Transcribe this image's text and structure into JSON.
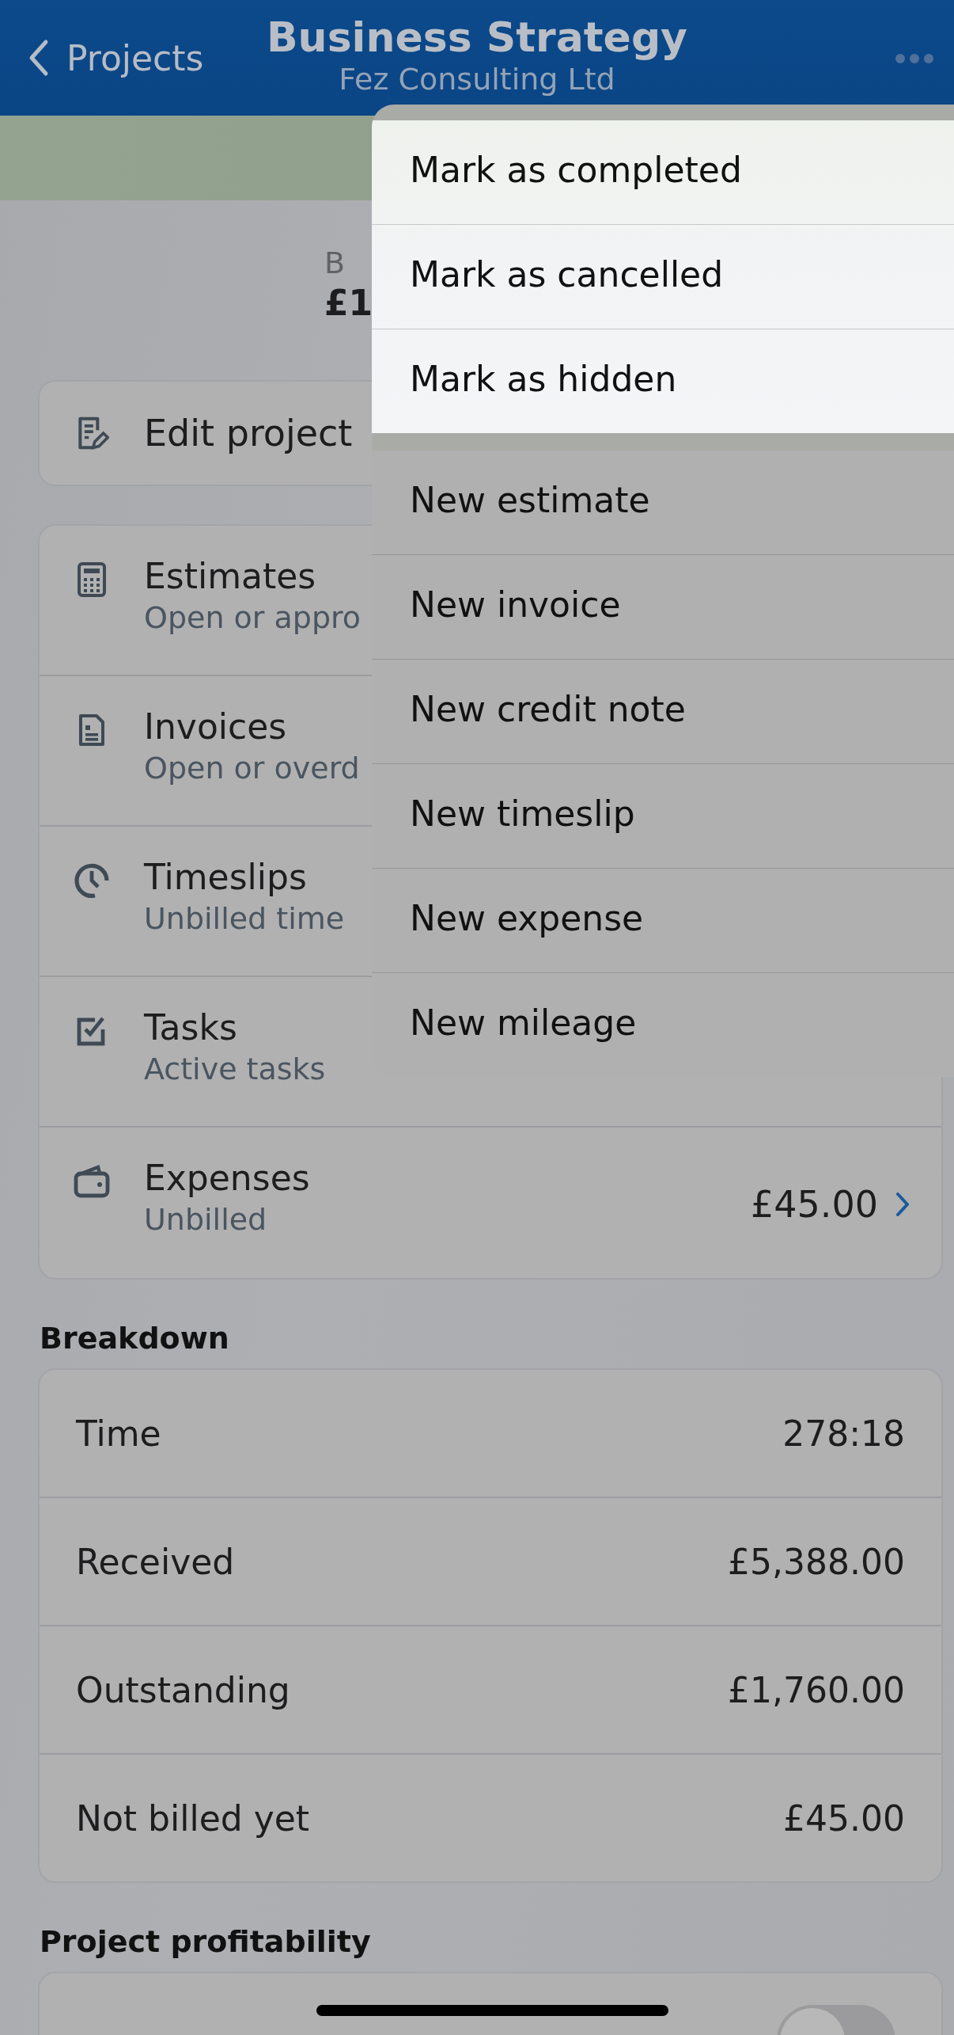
{
  "nav_bar": {
    "back_label": "Projects",
    "title": "Business Strategy",
    "subtitle": "Fez Consulting Ltd"
  },
  "summary": {
    "label": "B",
    "amount": "£1"
  },
  "edit_button": {
    "label": "Edit project"
  },
  "sections": [
    {
      "kind": "estimates",
      "title": "Estimates",
      "subtitle": "Open or appro"
    },
    {
      "kind": "invoices",
      "title": "Invoices",
      "subtitle": "Open or overd"
    },
    {
      "kind": "timeslips",
      "title": "Timeslips",
      "subtitle": "Unbilled time"
    },
    {
      "kind": "tasks",
      "title": "Tasks",
      "subtitle": "Active tasks"
    },
    {
      "kind": "expenses",
      "title": "Expenses",
      "subtitle": "Unbilled",
      "value": "£45.00"
    }
  ],
  "breakdown": {
    "heading": "Breakdown",
    "rows": [
      {
        "label": "Time",
        "value": "278:18"
      },
      {
        "label": "Received",
        "value": "£5,388.00"
      },
      {
        "label": "Outstanding",
        "value": "£1,760.00"
      },
      {
        "label": "Not billed yet",
        "value": "£45.00"
      }
    ]
  },
  "profitability": {
    "heading": "Project profitability",
    "toggle": {
      "on": false
    }
  },
  "menu": {
    "groups": [
      {
        "kind": "primary",
        "items": [
          "Mark as completed",
          "Mark as cancelled",
          "Mark as hidden"
        ]
      },
      {
        "kind": "secondary",
        "items": [
          "New estimate",
          "New invoice",
          "New credit note",
          "New timeslip",
          "New expense",
          "New mileage"
        ]
      }
    ]
  }
}
